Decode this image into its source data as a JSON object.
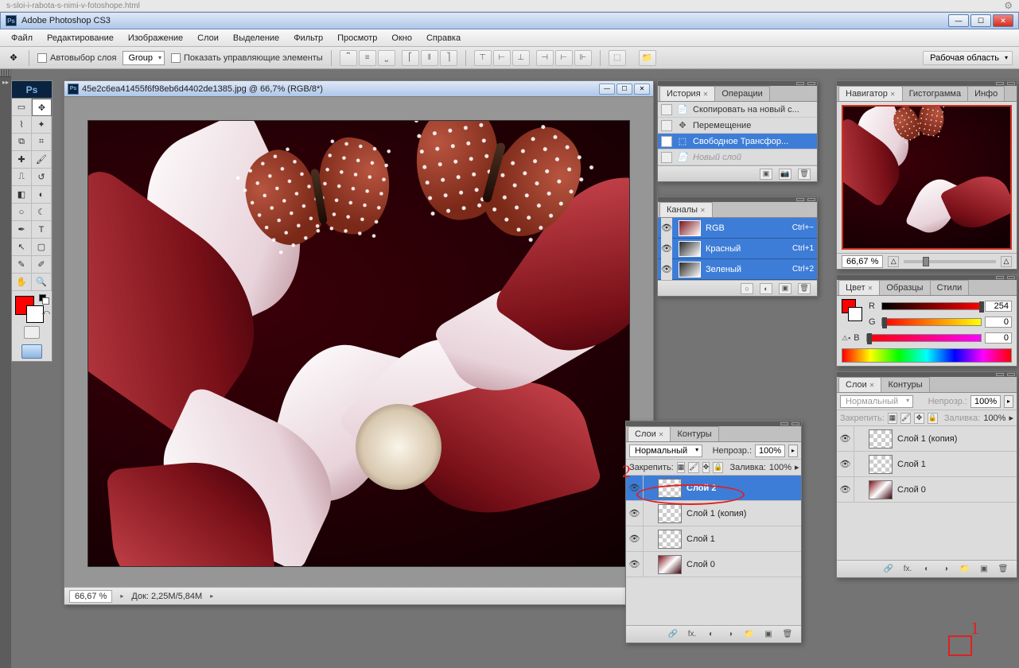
{
  "browser_address": "s-sloi-i-rabota-s-nimi-v-fotoshope.html",
  "app_title": "Adobe Photoshop CS3",
  "menu": [
    "Файл",
    "Редактирование",
    "Изображение",
    "Слои",
    "Выделение",
    "Фильтр",
    "Просмотр",
    "Окно",
    "Справка"
  ],
  "options": {
    "autoselect": "Автовыбор слоя",
    "group": "Group",
    "show_controls": "Показать управляющие элементы",
    "workspace": "Рабочая область"
  },
  "document": {
    "title": "45e2c6ea41455f6f98eb6d4402de1385.jpg @ 66,7% (RGB/8*)",
    "zoom": "66,67 %",
    "docinfo": "Док: 2,25M/5,84M"
  },
  "history": {
    "tab_history": "История",
    "tab_actions": "Операции",
    "items": [
      {
        "label": "Скопировать на новый с...",
        "selected": false
      },
      {
        "label": "Перемещение",
        "selected": false
      },
      {
        "label": "Свободное Трансфор...",
        "selected": true
      },
      {
        "label": "Новый слой",
        "dim": true
      }
    ]
  },
  "channels": {
    "tab": "Каналы",
    "rows": [
      {
        "name": "RGB",
        "sc": "Ctrl+~",
        "gray": false
      },
      {
        "name": "Красный",
        "sc": "Ctrl+1",
        "gray": true
      },
      {
        "name": "Зеленый",
        "sc": "Ctrl+2",
        "gray": true
      }
    ]
  },
  "layers_floating": {
    "tab_layers": "Слои",
    "tab_paths": "Контуры",
    "blend": "Нормальный",
    "opacity_label": "Непрозр.:",
    "opacity_value": "100%",
    "lock_label": "Закрепить:",
    "fill_label": "Заливка:",
    "fill_value": "100%",
    "rows": [
      {
        "name": "Слой 2",
        "thumb": "checker",
        "selected": true
      },
      {
        "name": "Слой 1 (копия)",
        "thumb": "checker"
      },
      {
        "name": "Слой 1",
        "thumb": "checker"
      },
      {
        "name": "Слой 0",
        "thumb": "flower"
      }
    ]
  },
  "layers_docked": {
    "tab_layers": "Слои",
    "tab_paths": "Контуры",
    "blend": "Нормальный",
    "opacity_label": "Непрозр.:",
    "opacity_value": "100%",
    "lock_label": "Закрепить:",
    "fill_label": "Заливка:",
    "fill_value": "100%",
    "rows": [
      {
        "name": "Слой 1 (копия)",
        "thumb": "checker"
      },
      {
        "name": "Слой 1",
        "thumb": "checker"
      },
      {
        "name": "Слой 0",
        "thumb": "flower"
      }
    ]
  },
  "navigator": {
    "tab_nav": "Навигатор",
    "tab_hist": "Гистограмма",
    "tab_info": "Инфо",
    "zoom": "66,67 %"
  },
  "color": {
    "tab_color": "Цвет",
    "tab_swatches": "Образцы",
    "tab_styles": "Стили",
    "r": "254",
    "g": "0",
    "b": "0"
  },
  "annotations": {
    "one": "1",
    "two": "2"
  }
}
